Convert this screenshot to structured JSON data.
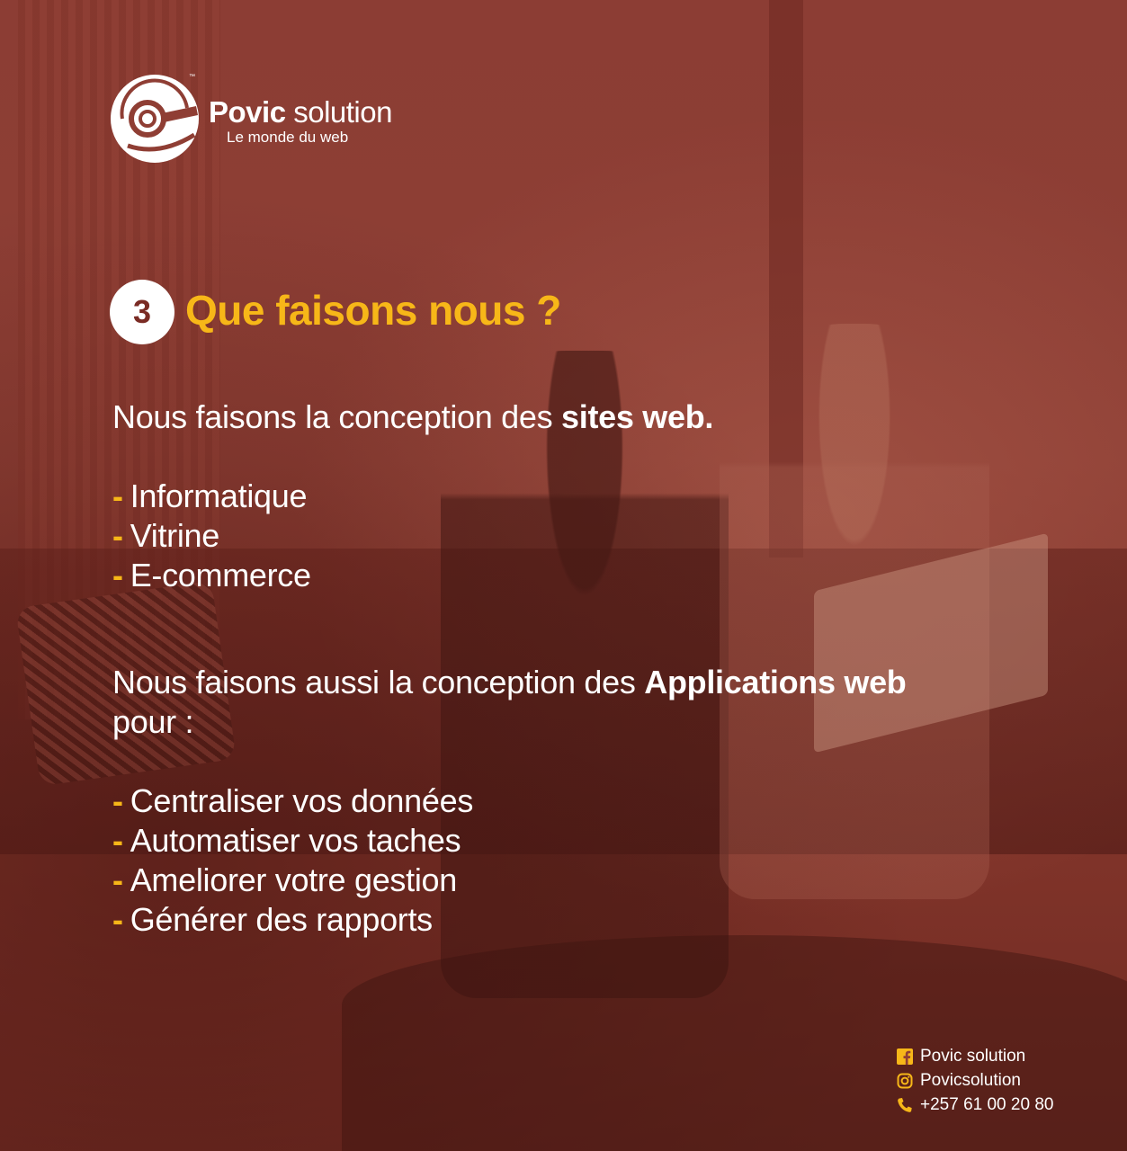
{
  "brand": {
    "name_bold": "Povic",
    "name_light": "solution",
    "tagline": "Le monde du web",
    "trademark": "™"
  },
  "section": {
    "number": "3",
    "title": "Que faisons nous ?"
  },
  "intro": {
    "text": "Nous faisons la conception des ",
    "highlight": "sites web."
  },
  "site_types": [
    "Informatique",
    "Vitrine",
    "E-commerce"
  ],
  "apps": {
    "text_before": "Nous faisons aussi la conception des ",
    "highlight": "Applications web",
    "text_after": " pour :"
  },
  "app_benefits": [
    "Centraliser vos données",
    "Automatiser vos taches",
    "Ameliorer votre gestion",
    "Générer des rapports"
  ],
  "bullet": "-",
  "contacts": {
    "facebook": "Povic solution",
    "instagram": "Povicsolution",
    "phone": "+257 61 00 20 80"
  },
  "colors": {
    "accent": "#f7b718",
    "background": "#8f3e34",
    "text": "#ffffff"
  },
  "icons": [
    "facebook-icon",
    "instagram-icon",
    "phone-icon"
  ]
}
